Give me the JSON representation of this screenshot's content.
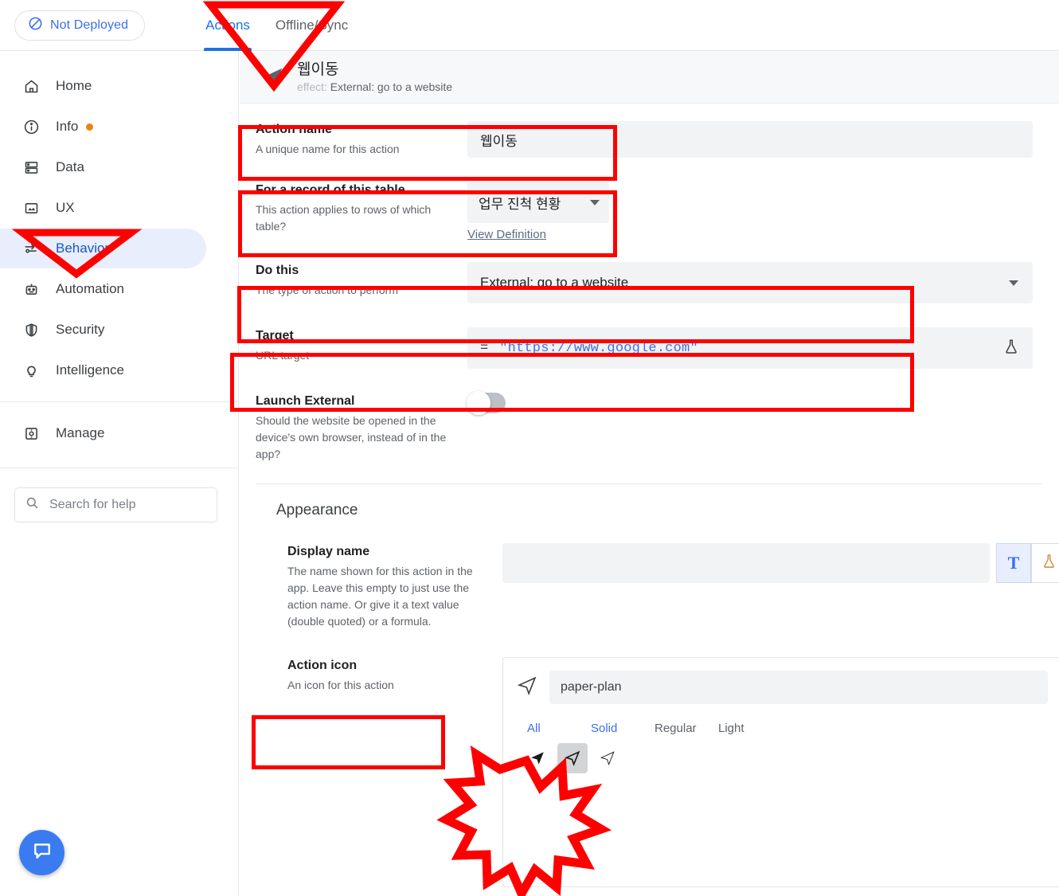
{
  "topbar": {
    "deploy_status": "Not Deployed",
    "deploy_icon": "no-deploy-icon",
    "tabs": [
      {
        "label": "Actions",
        "active": true
      },
      {
        "label": "Offline/Sync",
        "active": false
      }
    ]
  },
  "sidebar": {
    "items": [
      {
        "label": "Home",
        "icon": "home-icon",
        "badge": false,
        "selected": false
      },
      {
        "label": "Info",
        "icon": "info-icon",
        "badge": true,
        "selected": false
      },
      {
        "label": "Data",
        "icon": "database-icon",
        "badge": false,
        "selected": false
      },
      {
        "label": "UX",
        "icon": "image-icon",
        "badge": false,
        "selected": false
      },
      {
        "label": "Behavior",
        "icon": "behavior-icon",
        "badge": false,
        "selected": true
      },
      {
        "label": "Automation",
        "icon": "robot-icon",
        "badge": false,
        "selected": false
      },
      {
        "label": "Security",
        "icon": "shield-icon",
        "badge": false,
        "selected": false
      },
      {
        "label": "Intelligence",
        "icon": "lightbulb-icon",
        "badge": false,
        "selected": false
      },
      {
        "label": "Manage",
        "icon": "settings-icon",
        "badge": false,
        "selected": false
      }
    ],
    "search_placeholder": "Search for help",
    "search_icon": "search-icon",
    "chat_icon": "chat-bubble-icon"
  },
  "action_header": {
    "icon": "paper-plane-icon",
    "name": "웹이동",
    "effect_key": "effect:",
    "effect_value": "External: go to a website"
  },
  "form": {
    "action_name": {
      "label": "Action name",
      "sub": "A unique name for this action",
      "value": "웹이동"
    },
    "table": {
      "label": "For a record of this table",
      "sub": "This action applies to rows of which table?",
      "value": "업무 진척 현황",
      "link": "View Definition"
    },
    "do_this": {
      "label": "Do this",
      "sub": "The type of action to perform",
      "value": "External: go to a website"
    },
    "target": {
      "label": "Target",
      "sub": "URL target",
      "equals": "=",
      "value": "\"https://www.google.com\"",
      "flask_icon": "flask-icon"
    },
    "launch_external": {
      "label": "Launch External",
      "sub": "Should the website be opened in the device's own browser, instead of in the app?",
      "enabled": false
    }
  },
  "appearance": {
    "title": "Appearance",
    "display_name": {
      "label": "Display name",
      "sub": "The name shown for this action in the app. Leave this empty to just use the action name. Or give it a text value (double quoted) or a formula.",
      "value": "",
      "text_btn": "T",
      "flask_btn_icon": "flask-icon"
    },
    "action_icon": {
      "label": "Action icon",
      "sub": "An icon for this action",
      "icon_name": "paper-plan",
      "preview_icon": "paper-plane-icon",
      "tabs": [
        "All",
        "Solid",
        "Regular",
        "Light"
      ],
      "variants": [
        {
          "name": "paper-plane-solid-icon",
          "selected": false
        },
        {
          "name": "paper-plane-regular-icon",
          "selected": true
        },
        {
          "name": "paper-plane-light-icon",
          "selected": false
        }
      ]
    }
  },
  "annotations": {
    "color": "#ff0000",
    "boxes": [
      {
        "name": "action-name-highlight"
      },
      {
        "name": "table-highlight"
      },
      {
        "name": "do-this-highlight"
      },
      {
        "name": "target-highlight"
      },
      {
        "name": "action-icon-highlight"
      }
    ],
    "arrows": [
      {
        "name": "actions-tab-pointer"
      },
      {
        "name": "behavior-nav-pointer"
      }
    ],
    "burst": {
      "name": "icon-variant-burst"
    }
  }
}
